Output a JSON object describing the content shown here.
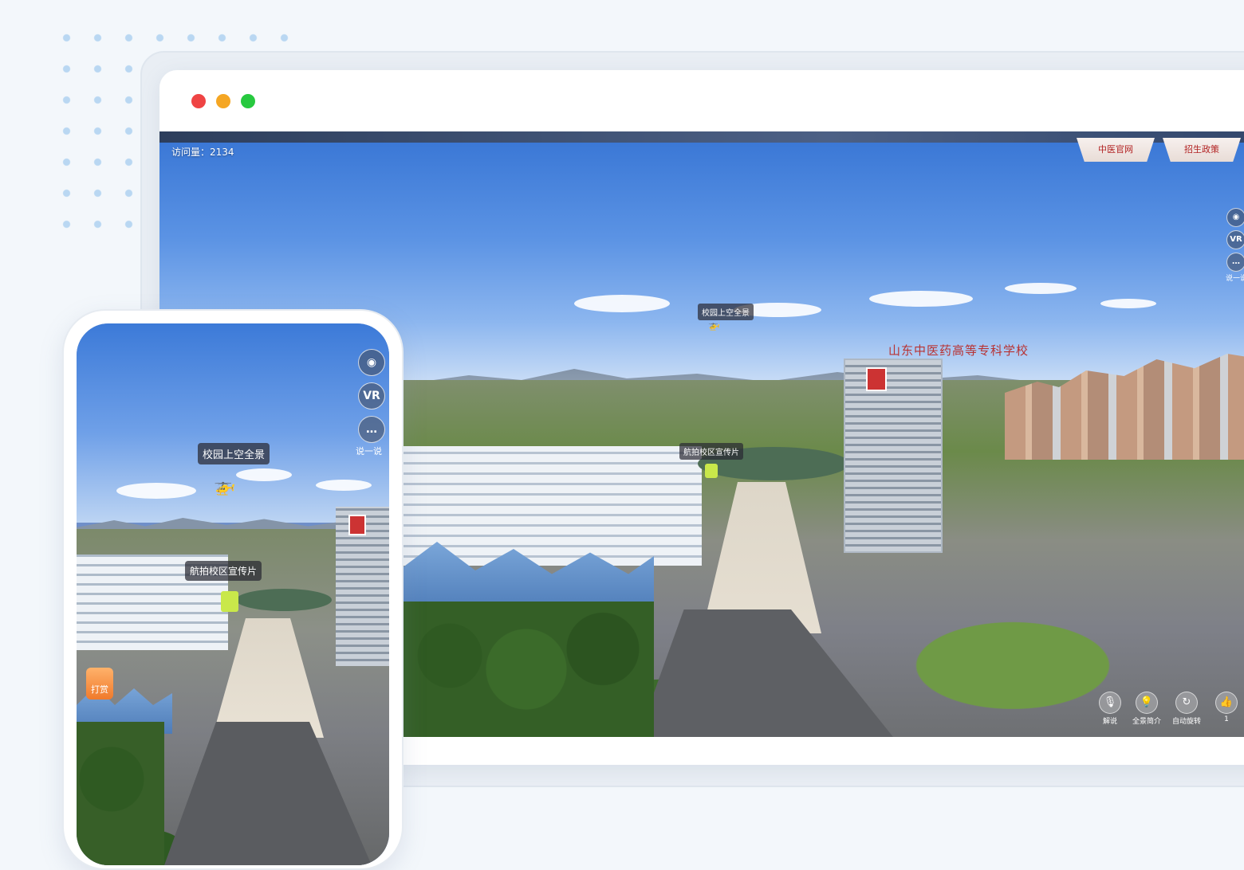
{
  "desktop": {
    "visit_count": "访问量：2134",
    "nav": {
      "official_site": "中医官网",
      "admission_policy": "招生政策"
    },
    "side_tools": {
      "view_icon": "eye-icon",
      "vr_label": "VR",
      "comment_icon": "chat-icon",
      "comment_label": "说一说"
    },
    "hotspots": {
      "aerial_panorama": "校园上空全景",
      "aerial_video": "航拍校区宣传片"
    },
    "building_sign": "山东中医药高等专科学校",
    "bottom_tools": [
      {
        "label": "解说",
        "icon": "microphone-icon"
      },
      {
        "label": "全景简介",
        "icon": "lightbulb-icon"
      },
      {
        "label": "自动旋转",
        "icon": "rotate-icon"
      },
      {
        "label": "1",
        "icon": "thumbs-up-icon"
      }
    ]
  },
  "mobile": {
    "side_tools": {
      "view_icon": "eye-icon",
      "vr_label": "VR",
      "comment_icon": "chat-icon",
      "comment_label": "说一说"
    },
    "hotspots": {
      "aerial_panorama": "校园上空全景",
      "aerial_video": "航拍校区宣传片"
    },
    "reward_label": "打赏"
  },
  "colors": {
    "page_background": "#f3f7fb",
    "dot_accent": "#b9d7f2",
    "close_dot": "#ef4444",
    "minimize_dot": "#f5a623",
    "maximize_dot": "#27c93f",
    "nav_text": "#b22222"
  }
}
